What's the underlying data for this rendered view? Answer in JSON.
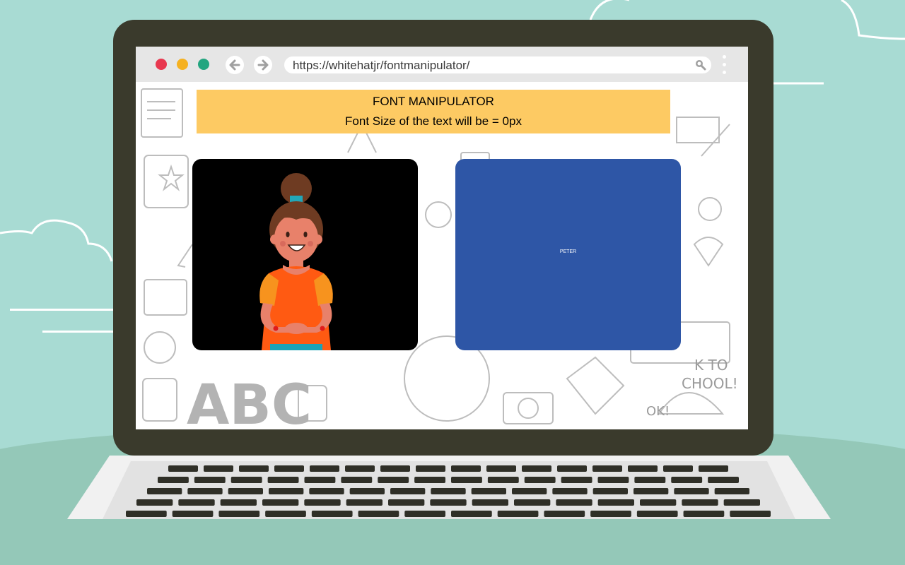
{
  "browser": {
    "url": "https://whitehatjr/fontmanipulator/"
  },
  "page": {
    "title": "FONT MANIPULATOR",
    "subtitle": "Font Size of the text will be = 0px",
    "sample_text": "PETER"
  },
  "colors": {
    "banner": "#fdca63",
    "text_panel": "#2e56a6",
    "video_panel": "#000000",
    "background": "#a8dbd3"
  },
  "icons": [
    "back-arrow-icon",
    "forward-arrow-icon",
    "search-icon",
    "menu-dots-icon"
  ]
}
